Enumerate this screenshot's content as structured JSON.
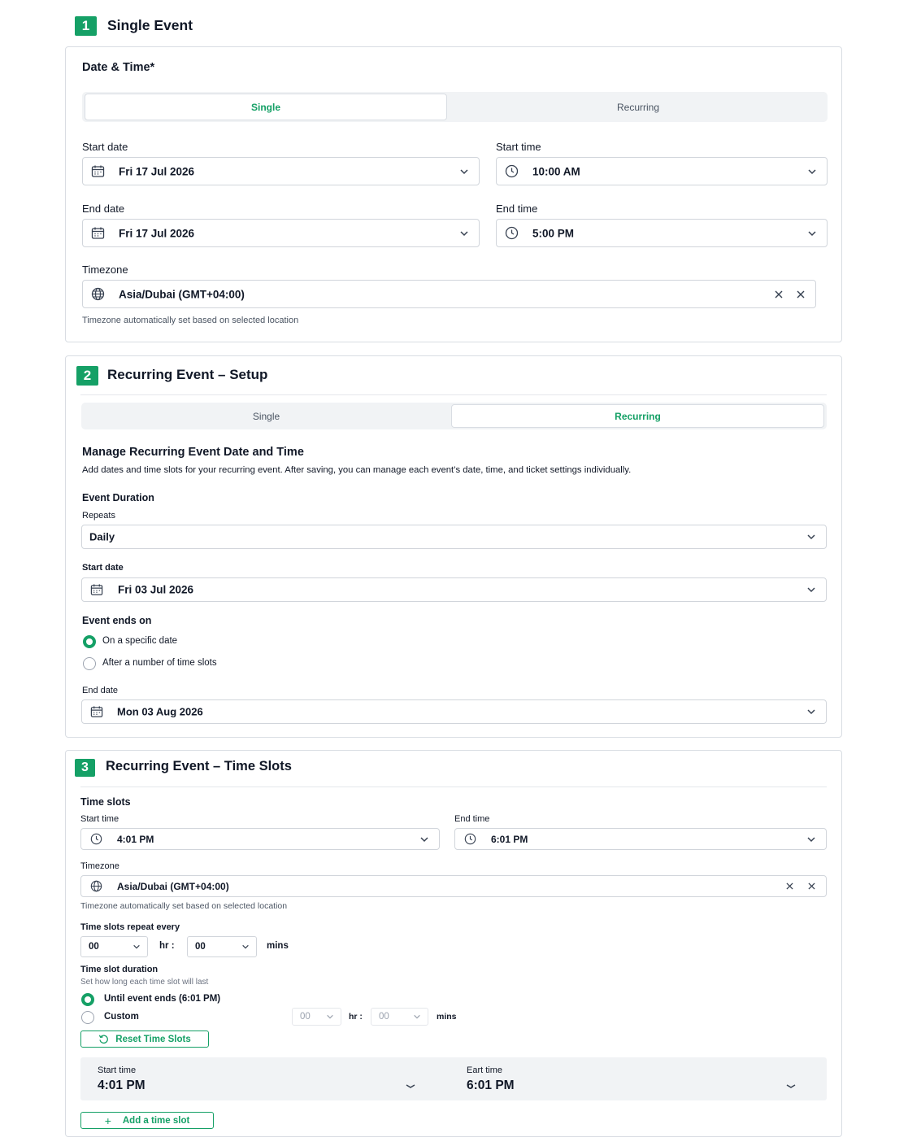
{
  "section1": {
    "number": "1",
    "title": "Single Event",
    "date_time_label": "Date & Time*",
    "tabs": {
      "single": "Single",
      "recurring": "Recurring",
      "active": "single"
    },
    "start_date_label": "Start date",
    "start_date": "Fri 17 Jul 2026",
    "start_time_label": "Start time",
    "start_time": "10:00 AM",
    "end_date_label": "End date",
    "end_date": "Fri 17 Jul 2026",
    "end_time_label": "End time",
    "end_time": "5:00 PM",
    "timezone_label": "Timezone",
    "timezone": "Asia/Dubai (GMT+04:00)",
    "timezone_helper": "Timezone automatically set based on selected location"
  },
  "section2": {
    "number": "2",
    "title": "Recurring Event – Setup",
    "tabs": {
      "single": "Single",
      "recurring": "Recurring",
      "active": "recurring"
    },
    "manage_title": "Manage Recurring Event Date and Time",
    "manage_desc": "Add dates and time slots for your recurring event. After saving, you can manage each event’s date, time, and ticket settings individually.",
    "duration_title": "Event Duration",
    "repeats_label": "Repeats",
    "repeats": "Daily",
    "start_date_label": "Start date",
    "start_date": "Fri 03 Jul 2026",
    "ends_on_label": "Event ends on",
    "ends_on_options": [
      "On a specific date",
      "After a number of time slots"
    ],
    "ends_on_selected": 0,
    "end_date_label": "End date",
    "end_date": "Mon 03 Aug 2026"
  },
  "section3": {
    "number": "3",
    "title": "Recurring Event – Time Slots",
    "time_slots_label": "Time slots",
    "start_time_label": "Start time",
    "start_time": "4:01 PM",
    "end_time_label": "End time",
    "end_time": "6:01 PM",
    "timezone_label": "Timezone",
    "timezone": "Asia/Dubai (GMT+04:00)",
    "timezone_helper": "Timezone automatically set based on selected location",
    "repeat_label": "Time slots repeat every",
    "repeat_hr": "00",
    "repeat_min": "00",
    "hr_unit": "hr :",
    "min_unit": "mins",
    "duration_label": "Time slot duration",
    "duration_helper": "Set how long each time slot will last",
    "duration_options": [
      "Until event ends (6:01 PM)",
      "Custom"
    ],
    "duration_selected": 0,
    "custom_hr": "00",
    "custom_min": "00",
    "reset_button": "Reset Time Slots",
    "slot": {
      "start_label": "Start time",
      "start_value": "4:01 PM",
      "end_label": "Eart time",
      "end_value": "6:01 PM"
    },
    "add_button": "Add a time slot"
  },
  "colors": {
    "accent": "#15a066",
    "border": "#d9dde3",
    "muted": "#4b5563"
  }
}
